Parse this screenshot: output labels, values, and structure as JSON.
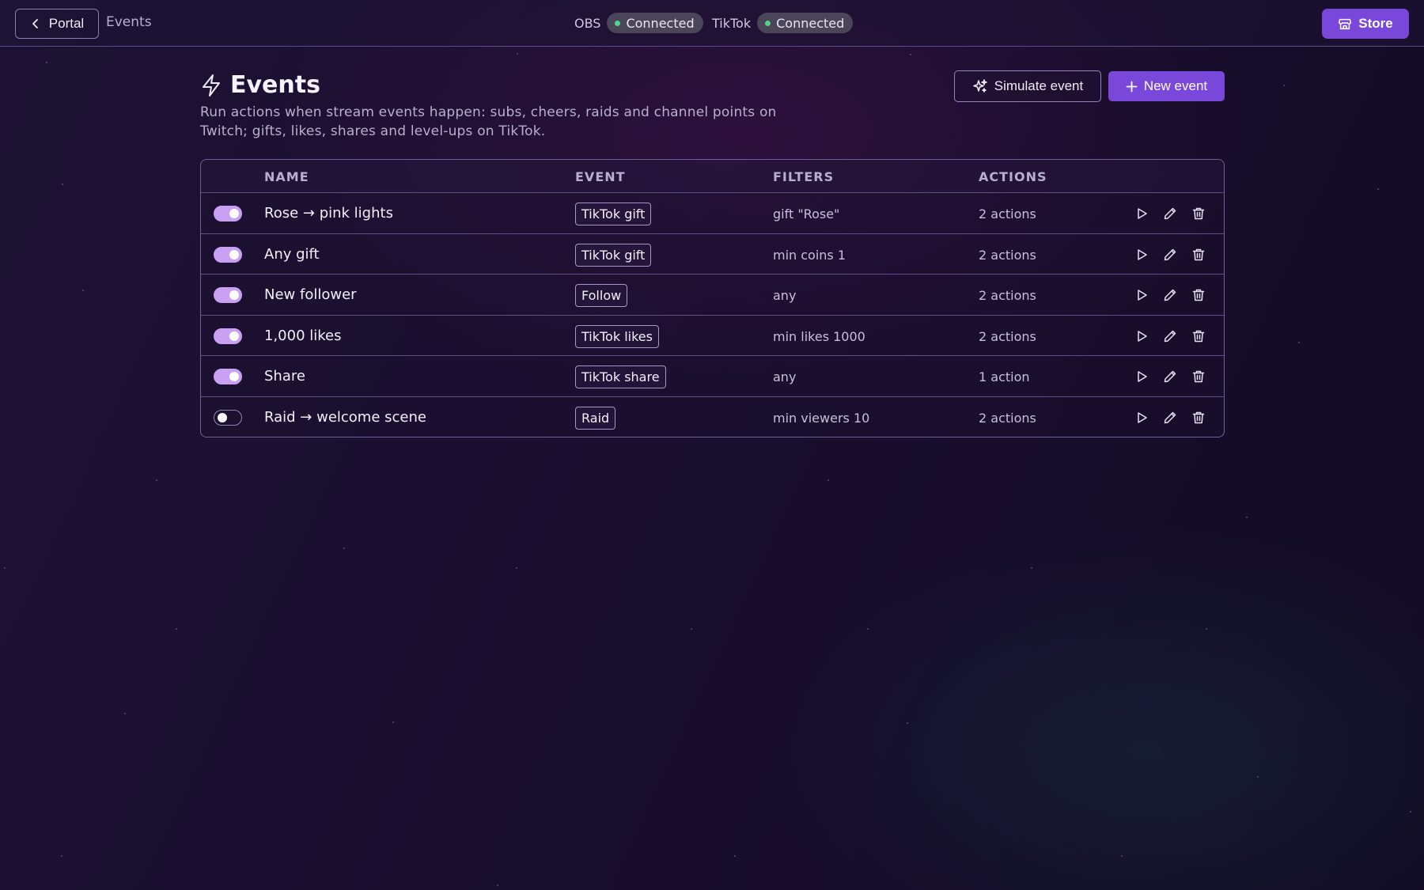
{
  "topbar": {
    "back_label": "Portal",
    "breadcrumb": "Events",
    "obs": {
      "label": "OBS",
      "status": "Connected"
    },
    "tiktok": {
      "label": "TikTok",
      "status": "Connected"
    },
    "store_label": "Store",
    "status_color": "#4fd48a"
  },
  "page": {
    "title": "Events",
    "subtitle": "Run actions when stream events happen: subs, cheers, raids and channel points on Twitch; gifts, likes, shares and level-ups on TikTok.",
    "simulate_label": "Simulate event",
    "new_label": "New event"
  },
  "table": {
    "headers": {
      "name": "NAME",
      "event": "EVENT",
      "filters": "FILTERS",
      "actions": "ACTIONS"
    },
    "rows": [
      {
        "enabled": true,
        "name": "Rose → pink lights",
        "event": "TikTok gift",
        "filter": "gift \"Rose\"",
        "actions": "2 actions"
      },
      {
        "enabled": true,
        "name": "Any gift",
        "event": "TikTok gift",
        "filter": "min coins 1",
        "actions": "2 actions"
      },
      {
        "enabled": true,
        "name": "New follower",
        "event": "Follow",
        "filter": "any",
        "actions": "2 actions"
      },
      {
        "enabled": true,
        "name": "1,000 likes",
        "event": "TikTok likes",
        "filter": "min likes 1000",
        "actions": "2 actions"
      },
      {
        "enabled": true,
        "name": "Share",
        "event": "TikTok share",
        "filter": "any",
        "actions": "1 action"
      },
      {
        "enabled": false,
        "name": "Raid → welcome scene",
        "event": "Raid",
        "filter": "min viewers 10",
        "actions": "2 actions"
      }
    ]
  },
  "colors": {
    "accent": "#7a47db",
    "toggle_on": "#c9a0f2"
  }
}
